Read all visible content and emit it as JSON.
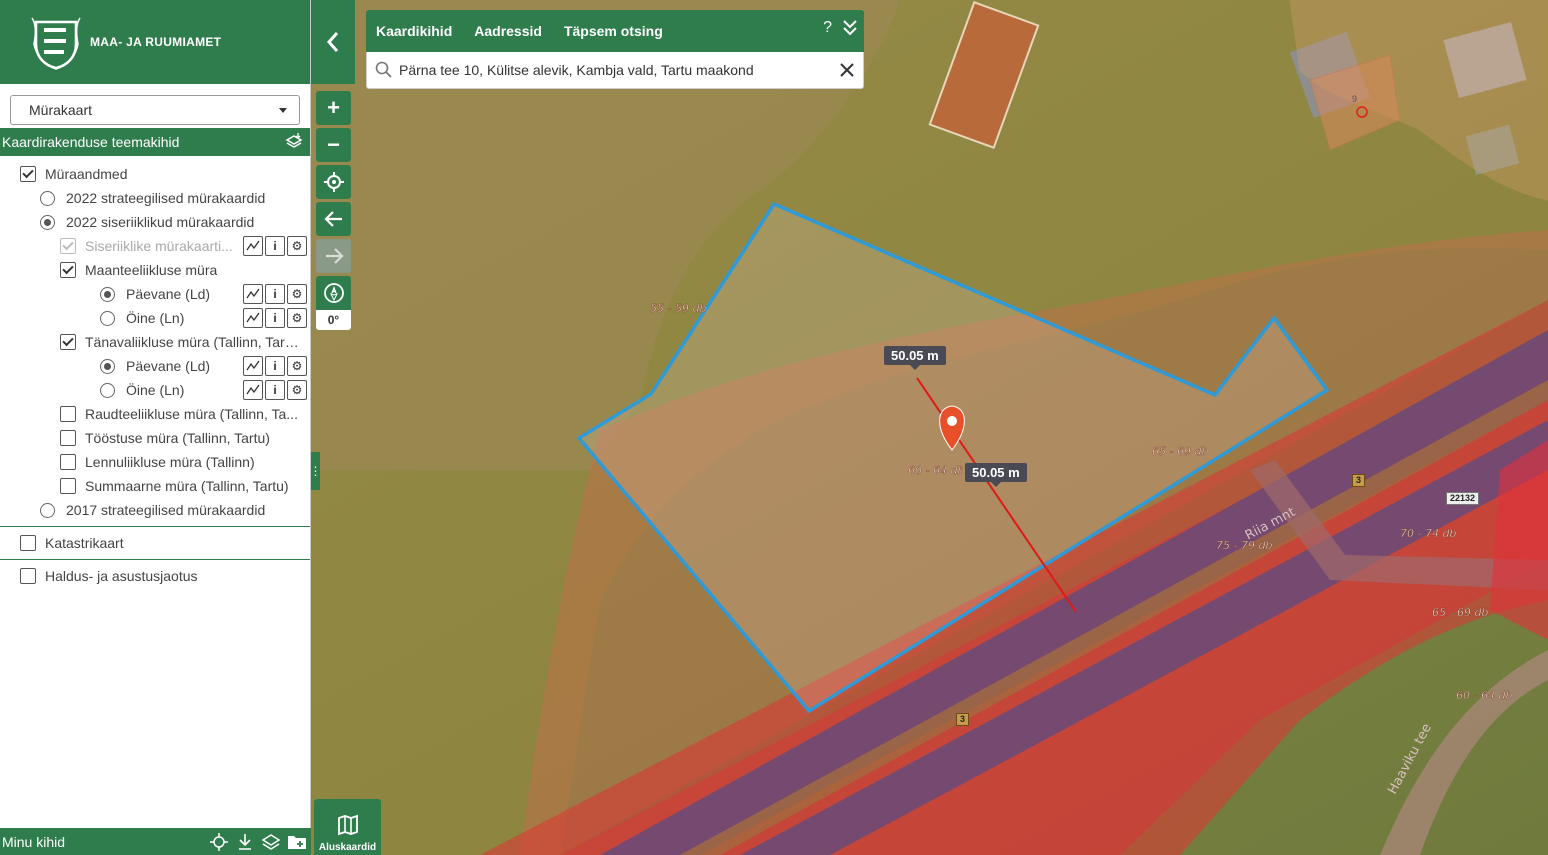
{
  "brand": {
    "name": "Maa- ja Ruumiamet"
  },
  "sidebar": {
    "basemap_select": "Mürakaart",
    "layers_header": "Kaardirakenduse teemakihid",
    "tree": [
      {
        "label": "Müraandmed"
      },
      {
        "label": "2022 strateegilised mürakaardid"
      },
      {
        "label": "2022 siseriiklikud mürakaardid"
      },
      {
        "label": "Siseriiklike mürakaarti..."
      },
      {
        "label": "Maanteeliikluse müra"
      },
      {
        "label": "Päevane (Ld)"
      },
      {
        "label": "Öine (Ln)"
      },
      {
        "label": "Tänavaliikluse müra (Tallinn, Tart..."
      },
      {
        "label": "Päevane (Ld)"
      },
      {
        "label": "Öine (Ln)"
      },
      {
        "label": "Raudteeliikluse müra (Tallinn, Ta..."
      },
      {
        "label": "Tööstuse müra (Tallinn, Tartu)"
      },
      {
        "label": "Lennuliikluse müra (Tallinn)"
      },
      {
        "label": "Summaarne müra (Tallinn, Tartu)"
      },
      {
        "label": "2017 strateegilised mürakaardid"
      },
      {
        "label": "Katastrikaart"
      },
      {
        "label": "Haldus- ja asustusjaotus"
      }
    ],
    "my_layers": "Minu kihid"
  },
  "controls": {
    "zoom_in": "+",
    "zoom_out": "−",
    "rotation": "0°",
    "basemaps_label": "Aluskaardid"
  },
  "search": {
    "tabs": [
      "Kaardikihid",
      "Aadressid",
      "Täpsem otsing"
    ],
    "help": "?",
    "value": "Pärna tee 10, Külitse alevik, Kambja vald, Tartu maakond"
  },
  "map": {
    "noise_labels": [
      "55 - 59 db",
      "60 - 64 db",
      "65 - 69 db",
      "75 - 79 db",
      "70 - 74 db",
      "65 - 69 db",
      "60 - 64 db"
    ],
    "measurements": [
      "50.05 m",
      "50.05 m"
    ],
    "road_names": [
      "Riia mnt",
      "Haaviku tee"
    ],
    "road_shields": [
      "3",
      "3",
      "22132"
    ],
    "house_number": "9"
  }
}
